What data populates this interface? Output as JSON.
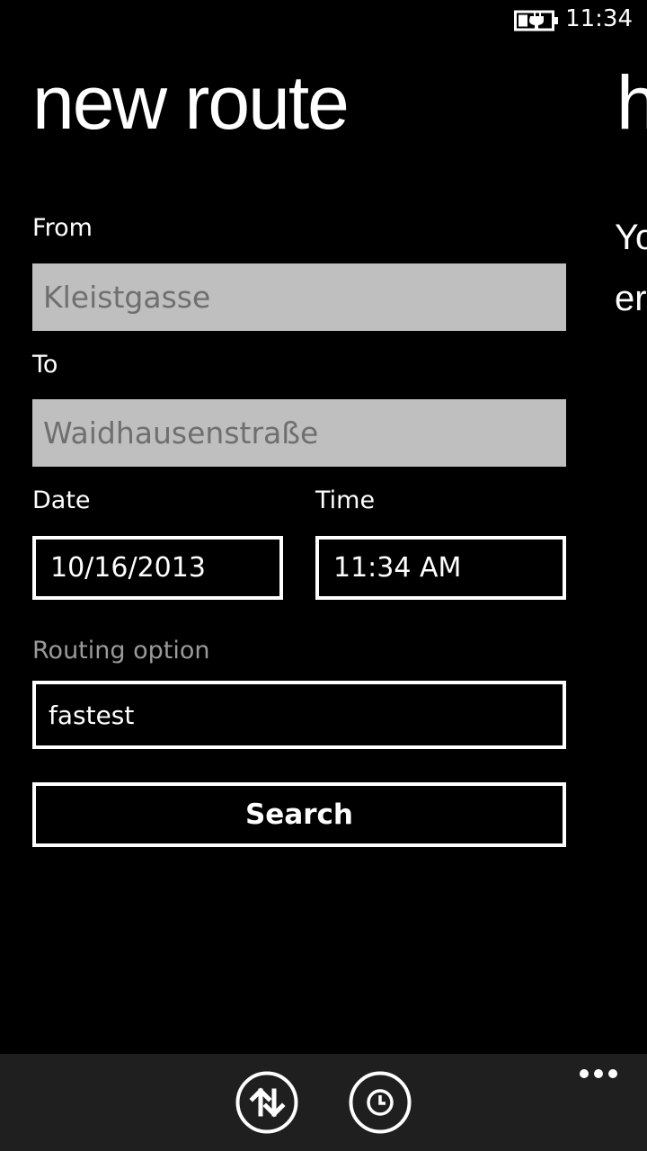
{
  "status_bar": {
    "time": "11:34",
    "battery_icon": "battery-charging-icon"
  },
  "page": {
    "title": "new route",
    "next_pivot_title_peek": "h",
    "next_pivot_text_peek": [
      "Yo",
      "er"
    ]
  },
  "form": {
    "from": {
      "label": "From",
      "value": "Kleistgasse"
    },
    "to": {
      "label": "To",
      "value": "Waidhausenstraße"
    },
    "date": {
      "label": "Date",
      "value": "10/16/2013"
    },
    "time": {
      "label": "Time",
      "value": "11:34 AM"
    },
    "routing_option": {
      "label": "Routing option",
      "value": "fastest"
    },
    "search_label": "Search"
  },
  "app_bar": {
    "buttons": [
      {
        "icon": "swap-direction-icon"
      },
      {
        "icon": "clock-icon"
      }
    ],
    "more_icon": "ellipsis-icon"
  },
  "colors": {
    "background": "#000000",
    "text": "#ffffff",
    "textbox_background": "#bfbfbf",
    "textbox_text": "#6f6f6f",
    "dim_label": "#9a9a9a",
    "app_bar_background": "#1f1f1f"
  }
}
